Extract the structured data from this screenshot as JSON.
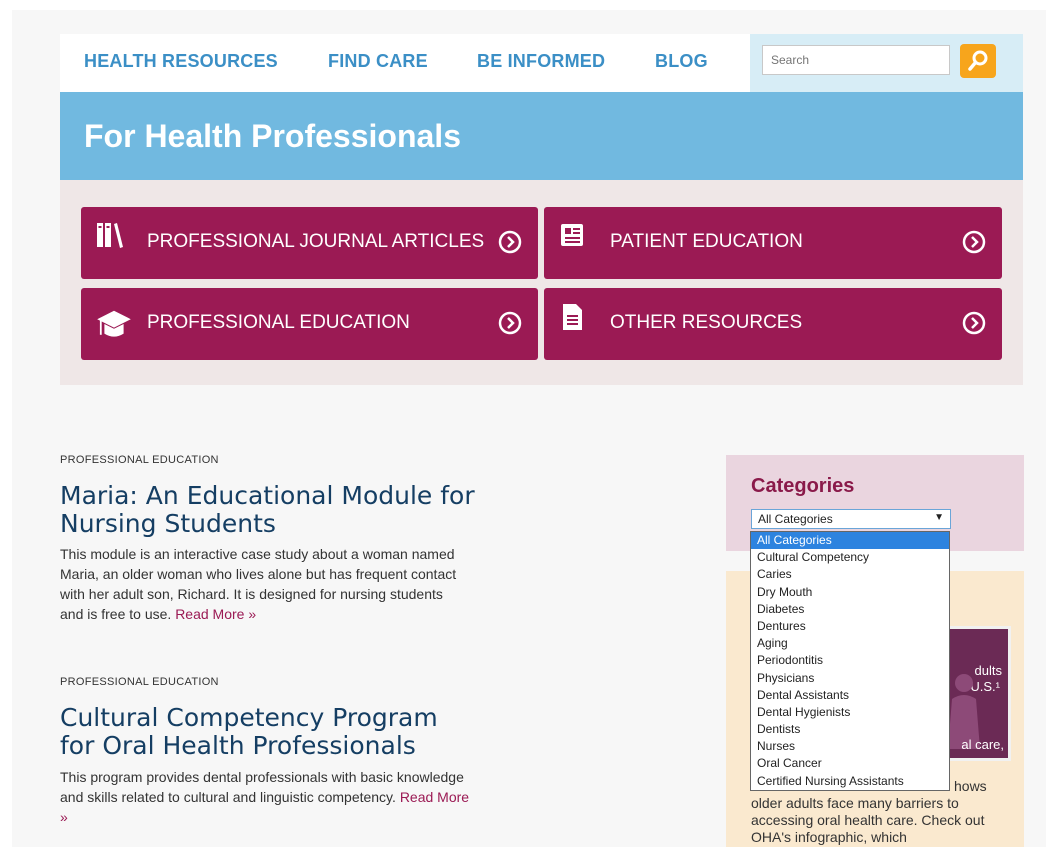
{
  "nav": {
    "links": [
      "HEALTH RESOURCES",
      "FIND CARE",
      "BE INFORMED",
      "BLOG"
    ],
    "search_placeholder": "Search"
  },
  "banner": {
    "title": "For Health Professionals"
  },
  "tiles": [
    {
      "label": "PROFESSIONAL JOURNAL ARTICLES",
      "icon": "books-icon"
    },
    {
      "label": "PATIENT EDUCATION",
      "icon": "newspaper-icon"
    },
    {
      "label": "PROFESSIONAL EDUCATION",
      "icon": "graduation-cap-icon"
    },
    {
      "label": "OTHER RESOURCES",
      "icon": "document-icon"
    }
  ],
  "posts": [
    {
      "kicker": "PROFESSIONAL EDUCATION",
      "title": "Maria: An Educational Module for Nursing Students",
      "excerpt": "This module is an interactive case study about a woman named Maria, an older woman who lives alone but has frequent contact with her adult son, Richard. It is designed for nursing students and is free to use.",
      "read_more": "Read More »"
    },
    {
      "kicker": "PROFESSIONAL EDUCATION",
      "title": "Cultural Competency Program for Oral Health Professionals",
      "excerpt": "This program provides dental professionals with basic knowledge and skills related to cultural and linguistic competency.",
      "read_more": "Read More »"
    }
  ],
  "categories": {
    "title": "Categories",
    "selected": "All Categories",
    "arrow": "▼",
    "options": [
      "All Categories",
      "Cultural Competency",
      "Caries",
      "Dry Mouth",
      "Diabetes",
      "Dentures",
      "Aging",
      "Periodontitis",
      "Physicians",
      "Dental Assistants",
      "Dental Hygienists",
      "Dentists",
      "Nurses",
      "Oral Cancer",
      "Certified Nursing Assistants"
    ]
  },
  "promo": {
    "image_text_1": "dults",
    "image_text_2": "U.S.¹",
    "image_text_3": "al care,",
    "text_hows": "hows",
    "text_rest": "older adults face many barriers to accessing oral health care. Check out OHA's infographic, which"
  },
  "colors": {
    "nav_link": "#3b8fc6",
    "banner": "#71b9e0",
    "tile": "#9b1a54",
    "title_navy": "#153e63",
    "search_button": "#f7a51c"
  }
}
